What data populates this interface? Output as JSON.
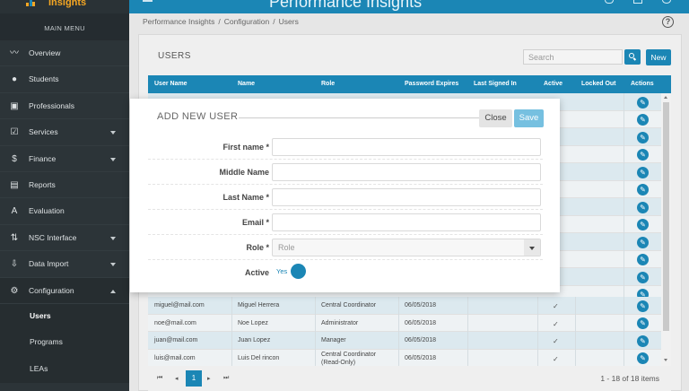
{
  "app": {
    "logo_text": "Insights",
    "title": "Performance Insights"
  },
  "sidebar": {
    "header": "MAIN MENU",
    "items": [
      {
        "label": "Overview",
        "icon": "chart-line-icon",
        "glyph": "〰"
      },
      {
        "label": "Students",
        "icon": "people-icon",
        "glyph": "👥"
      },
      {
        "label": "Professionals",
        "icon": "briefcase-icon",
        "glyph": "▣"
      },
      {
        "label": "Services",
        "icon": "calendar-check-icon",
        "glyph": "☑"
      },
      {
        "label": "Finance",
        "icon": "dollar-icon",
        "glyph": "$"
      },
      {
        "label": "Reports",
        "icon": "clipboard-icon",
        "glyph": "▤"
      },
      {
        "label": "Evaluation",
        "icon": "spellcheck-icon",
        "glyph": "A"
      },
      {
        "label": "NSC Interface",
        "icon": "swap-vertical-icon",
        "glyph": "⇅"
      },
      {
        "label": "Data Import",
        "icon": "import-icon",
        "glyph": "⇩"
      },
      {
        "label": "Configuration",
        "icon": "gear-icon",
        "glyph": "⚙"
      }
    ],
    "subitems": [
      {
        "label": "Users"
      },
      {
        "label": "Programs"
      },
      {
        "label": "LEAs"
      }
    ]
  },
  "breadcrumb": [
    "Performance Insights",
    "Configuration",
    "Users"
  ],
  "users_panel": {
    "title": "USERS",
    "search_placeholder": "Search",
    "new_label": "New",
    "columns": [
      "User Name",
      "Name",
      "Role",
      "Password Expires",
      "Last Signed In",
      "Active",
      "Locked Out",
      "Actions"
    ],
    "rows": [
      {
        "username": "miguel@mail.com",
        "name": "Miguel Herrera",
        "role": "Central Coordinator",
        "expires": "06/05/2018",
        "active": "✓"
      },
      {
        "username": "noe@mail.com",
        "name": "Noe Lopez",
        "role": "Administrator",
        "expires": "06/05/2018",
        "active": "✓"
      },
      {
        "username": "juan@mail.com",
        "name": "Juan Lopez",
        "role": "Manager",
        "expires": "06/05/2018",
        "active": "✓"
      },
      {
        "username": "luis@mail.com",
        "name": "Luis Del rincon",
        "role": "Central Coordinator (Read-Only)",
        "expires": "06/05/2018",
        "active": "✓"
      }
    ],
    "pager": {
      "current_page": "1",
      "info": "1 - 18 of 18 items",
      "first": "⏮",
      "prev": "◂",
      "next": "▸",
      "last": "⏭"
    }
  },
  "modal": {
    "title": "ADD NEW USER",
    "close_label": "Close",
    "save_label": "Save",
    "fields": {
      "first_name": "First name *",
      "middle_name": "Middle Name",
      "last_name": "Last Name *",
      "email": "Email *",
      "role": "Role *",
      "role_placeholder": "Role",
      "active": "Active",
      "active_value": "Yes"
    }
  },
  "colors": {
    "accent": "#1b86b5",
    "sidebar": "#2c3438",
    "logo": "#f4a623"
  }
}
